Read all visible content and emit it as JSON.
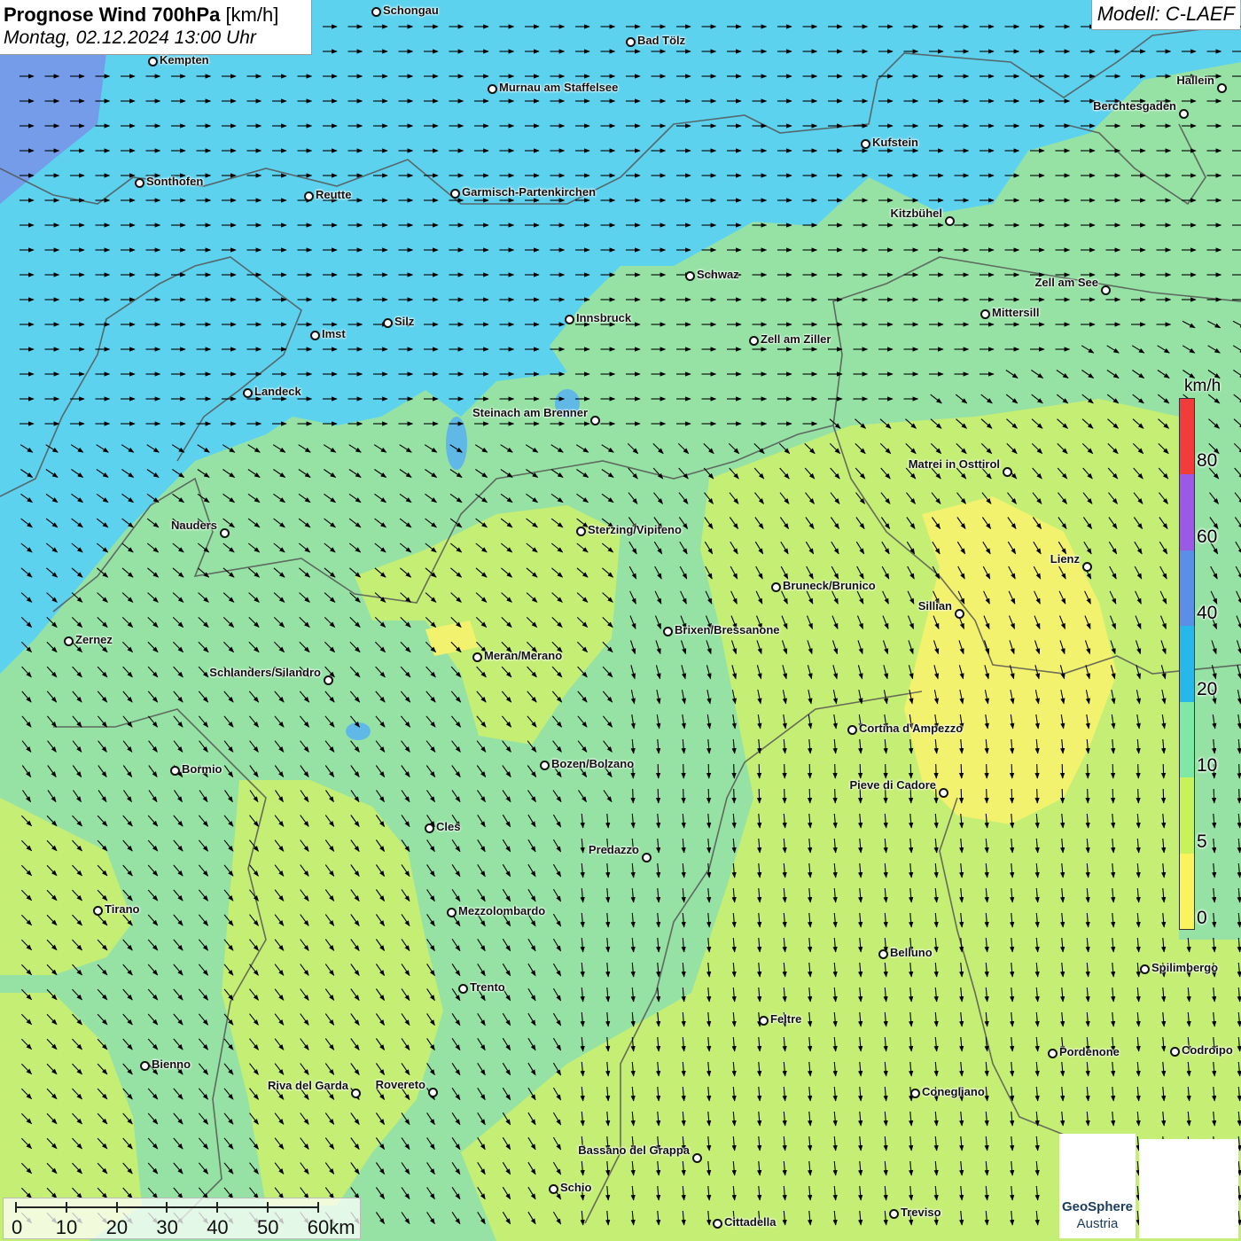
{
  "header": {
    "title_bold": "Prognose Wind 700hPa",
    "title_unit": "[km/h]",
    "subtitle": "Montag, 02.12.2024 13:00 Uhr"
  },
  "model": {
    "label": "Modell: C-LAEF"
  },
  "legend": {
    "unit": "km/h",
    "labels": [
      "80",
      "60",
      "40",
      "20",
      "10",
      "5",
      "0"
    ],
    "colors": [
      "#f23b3b",
      "#9a5ae4",
      "#5b8ee6",
      "#26b8ea",
      "#7fe8a4",
      "#c8f25a",
      "#fbf35e"
    ]
  },
  "scale": {
    "labels": [
      "0",
      "10",
      "20",
      "30",
      "40",
      "50",
      "60km"
    ]
  },
  "logo": {
    "line1": "GeoSphere",
    "line2": "Austria"
  },
  "cities": [
    "Schongau",
    "Bad Tölz",
    "Kempten",
    "Hallein",
    "Murnau am Staffelsee",
    "Berchtesgaden",
    "Kufstein",
    "Sonthofen",
    "Reutte",
    "Garmisch-Partenkirchen",
    "Kitzbühel",
    "Schwaz",
    "Zell am See",
    "Innsbruck",
    "Mittersill",
    "Silz",
    "Imst",
    "Zell am Ziller",
    "Landeck",
    "Steinach am Brenner",
    "Matrei in Osttirol",
    "Nauders",
    "Sterzing/Vipiteno",
    "Lienz",
    "Bruneck/Brunico",
    "Sillian",
    "Brixen/Bressanone",
    "Zernez",
    "Meran/Merano",
    "Schlanders/Silandro",
    "Cortina d'Ampezzo",
    "Bozen/Bolzano",
    "Bormio",
    "Pieve di Cadore",
    "Cles",
    "Predazzo",
    "Tirano",
    "Mezzolombardo",
    "Belluno",
    "Spilimbergo",
    "Trento",
    "Feltre",
    "Pordenone",
    "Codroipo",
    "Bienno",
    "Riva del Garda",
    "Rovereto",
    "Conegliano",
    "Bassano del Grappa",
    "Schio",
    "Treviso",
    "Cittadella"
  ]
}
